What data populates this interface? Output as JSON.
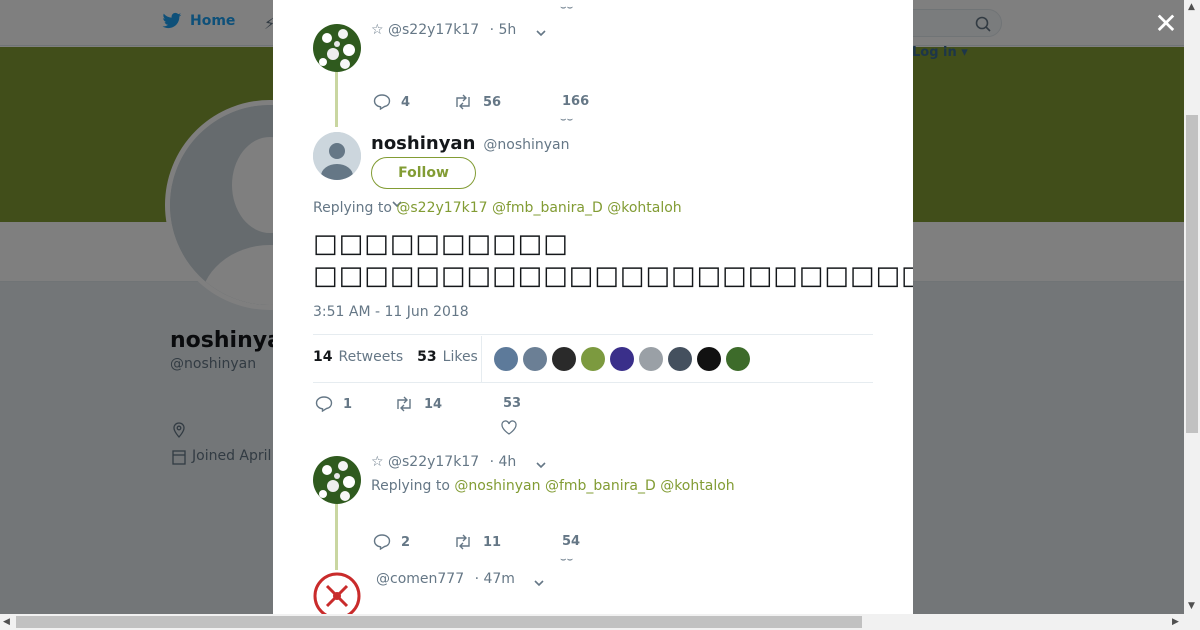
{
  "background": {
    "nav": {
      "home_label": "Home",
      "login_label": "Log in"
    },
    "profile": {
      "name": "noshinyan",
      "handle": "@noshinyan",
      "joined": "Joined April"
    }
  },
  "modal": {
    "prev_tweet": {
      "handle": "☆ @s22y17k17",
      "time": "· 5h",
      "replies": "4",
      "retweets": "56",
      "likes": "166"
    },
    "main_tweet": {
      "display_name": "noshinyan",
      "handle": "@noshinyan",
      "follow_label": "Follow",
      "replying_label": "Replying to",
      "replying_to": [
        "@s22y17k17",
        "@fmb_banira_D",
        "@kohtaloh"
      ],
      "text_line1": "□□□□□□□□□□",
      "text_line2": "□□□□□□□□□□□□□□□□□□□□□□□□□□□□□□□□□□□□□",
      "timestamp": "3:51 AM - 11 Jun 2018",
      "retweets_count": "14",
      "retweets_label": "Retweets",
      "likes_count": "53",
      "likes_label": "Likes",
      "replies": "1",
      "retweets": "14",
      "likes": "53"
    },
    "reply_tweet": {
      "handle": "☆ @s22y17k17",
      "time": "· 4h",
      "replying_label": "Replying to",
      "replying_to": [
        "@noshinyan",
        "@fmb_banira_D",
        "@kohtaloh"
      ],
      "replies": "2",
      "retweets": "11",
      "likes": "54"
    },
    "next_tweet": {
      "handle": "@comen777",
      "time": "· 47m"
    }
  },
  "colors": {
    "accent": "#829c34",
    "banner": "#829c34",
    "link": "#829c34"
  }
}
